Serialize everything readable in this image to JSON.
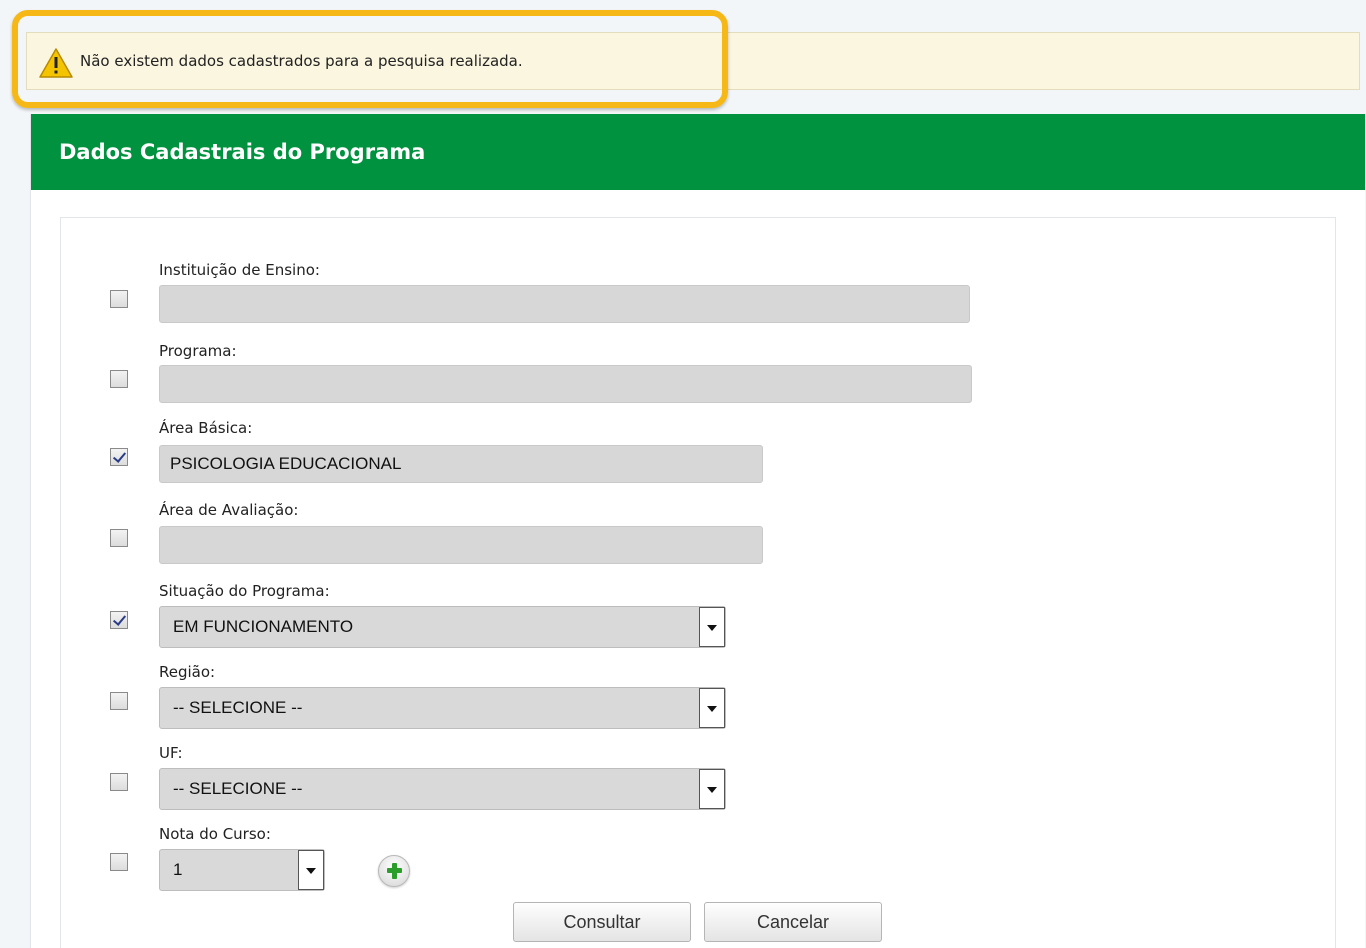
{
  "alert": {
    "message": "Não existem dados cadastrados para a pesquisa realizada.",
    "icon": "warning-icon"
  },
  "panel": {
    "title": "Dados Cadastrais do Programa"
  },
  "fields": {
    "instituicao": {
      "label": "Instituição de Ensino:",
      "value": "",
      "checked": false
    },
    "programa": {
      "label": "Programa:",
      "value": "",
      "checked": false
    },
    "area_basica": {
      "label": "Área Básica:",
      "value": "PSICOLOGIA EDUCACIONAL",
      "checked": true
    },
    "area_avaliacao": {
      "label": "Área de Avaliação:",
      "value": "",
      "checked": false
    },
    "situacao": {
      "label": "Situação do Programa:",
      "value": "EM FUNCIONAMENTO",
      "checked": true
    },
    "regiao": {
      "label": "Região:",
      "value": "-- SELECIONE --",
      "checked": false
    },
    "uf": {
      "label": "UF:",
      "value": "-- SELECIONE --",
      "checked": false
    },
    "nota": {
      "label": "Nota do Curso:",
      "value": "1",
      "checked": false
    }
  },
  "buttons": {
    "consultar": "Consultar",
    "cancelar": "Cancelar"
  },
  "colors": {
    "header_green": "#00923f",
    "highlight": "#f6b817",
    "alert_bg": "#fbf6df"
  }
}
